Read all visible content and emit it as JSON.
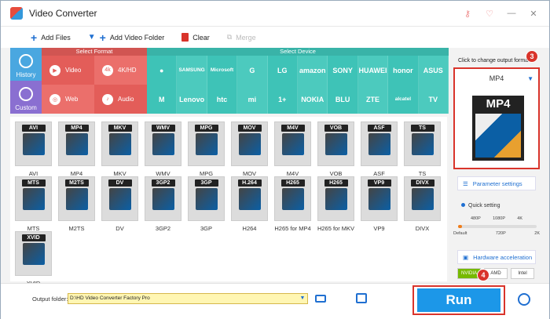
{
  "app": {
    "title": "Video Converter"
  },
  "titlebar": {
    "buttons": [
      "⚷",
      "♡",
      "—",
      "✕"
    ]
  },
  "toolbar": {
    "add_files": "Add Files",
    "add_video_folder": "Add Video Folder",
    "clear": "Clear",
    "merge": "Merge"
  },
  "left_tabs": {
    "history": "History",
    "custom": "Custom"
  },
  "select_format": {
    "header": "Select Format",
    "items": [
      "Video",
      "4K/HD",
      "Web",
      "Audio"
    ]
  },
  "select_device": {
    "header": "Select Device",
    "items": [
      "",
      "SAMSUNG",
      "Microsoft",
      "G",
      "LG",
      "amazon",
      "SONY",
      "HUAWEI",
      "honor",
      "ASUS",
      "M",
      "Lenovo",
      "htc",
      "mi",
      "1+",
      "NOKIA",
      "BLU",
      "ZTE",
      "alcatel",
      "TV"
    ]
  },
  "files": [
    {
      "badge": "AVI",
      "label": "AVI"
    },
    {
      "badge": "MP4",
      "label": "MP4"
    },
    {
      "badge": "MKV",
      "label": "MKV"
    },
    {
      "badge": "WMV",
      "label": "WMV"
    },
    {
      "badge": "MPG",
      "label": "MPG"
    },
    {
      "badge": "MOV",
      "label": "MOV"
    },
    {
      "badge": "M4V",
      "label": "M4V"
    },
    {
      "badge": "VOB",
      "label": "VOB"
    },
    {
      "badge": "ASF",
      "label": "ASF"
    },
    {
      "badge": "TS",
      "label": "TS"
    },
    {
      "badge": "MTS",
      "label": "MTS"
    },
    {
      "badge": "M2TS",
      "label": "M2TS"
    },
    {
      "badge": "DV",
      "label": "DV"
    },
    {
      "badge": "3GP2",
      "label": "3GP2"
    },
    {
      "badge": "3GP",
      "label": "3GP"
    },
    {
      "badge": "H.264",
      "label": "H264"
    },
    {
      "badge": "H265",
      "label": "H265 for MP4"
    },
    {
      "badge": "H265",
      "label": "H265 for MKV"
    },
    {
      "badge": "VP9",
      "label": "VP9"
    },
    {
      "badge": "DIVX",
      "label": "DIVX"
    },
    {
      "badge": "XVID",
      "label": "XVID"
    }
  ],
  "output": {
    "hint": "Click to change output format:",
    "format": "MP4",
    "image_label": "MP4",
    "badge_num": "3"
  },
  "settings": {
    "parameter_settings": "Parameter settings",
    "quick_setting": "Quick setting",
    "quick_top": [
      "480P",
      "1080P",
      "4K"
    ],
    "quick_bottom": [
      "Default",
      "720P",
      "2K"
    ],
    "quick_level": 0.05,
    "hardware_acceleration": "Hardware acceleration",
    "hw_chips": [
      "NVIDIA",
      "AMD",
      "Intel"
    ]
  },
  "bottom": {
    "output_folder_label": "Output folder:",
    "output_folder_value": "D:\\HD Video Converter Factory Pro",
    "run": "Run",
    "badge_num": "4"
  }
}
